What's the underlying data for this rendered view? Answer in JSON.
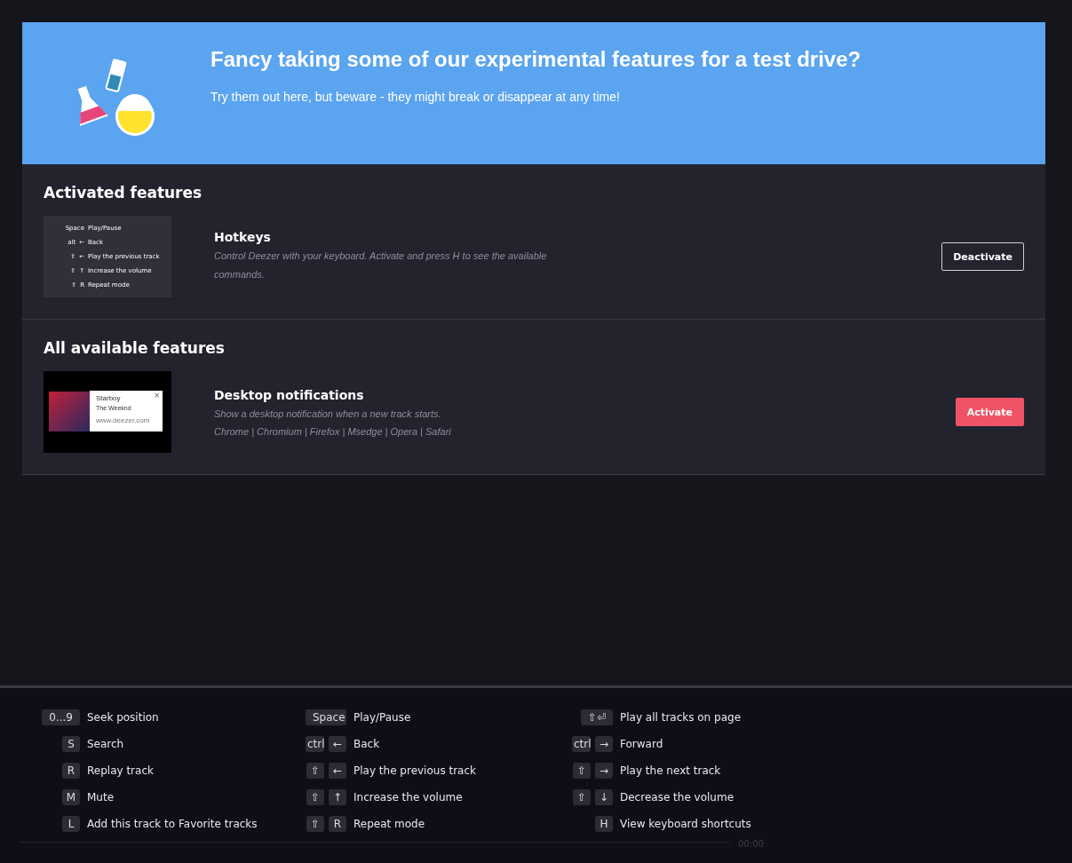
{
  "banner": {
    "title": "Fancy taking some of our experimental features for a test drive?",
    "subtitle": "Try them out here, but beware - they might break or disappear at any time!"
  },
  "sections": [
    {
      "heading": "Activated features",
      "features": [
        {
          "name": "Hotkeys",
          "description": "Control Deezer with your keyboard. Activate and press H to see the available commands.",
          "preview": {
            "kind": "hotkeys",
            "rows": [
              {
                "keys": [
                  "Space"
                ],
                "action": "Play/Pause"
              },
              {
                "keys": [
                  "alt",
                  "←"
                ],
                "action": "Back"
              },
              {
                "keys": [
                  "⇧",
                  "←"
                ],
                "action": "Play the previous track"
              },
              {
                "keys": [
                  "⇧",
                  "↑"
                ],
                "action": "Increase the volume"
              },
              {
                "keys": [
                  "⇧",
                  "R"
                ],
                "action": "Repeat mode"
              }
            ]
          },
          "button": {
            "label": "Deactivate",
            "kind": "outline"
          }
        }
      ]
    },
    {
      "heading": "All available features",
      "features": [
        {
          "name": "Desktop notifications",
          "description": "Show a desktop notification when a new track starts.",
          "browsers": "Chrome | Chromium | Firefox | Msedge | Opera | Safari",
          "preview": {
            "kind": "notification",
            "title": "Starboy",
            "artist": "The Weeknd",
            "url": "www.deezer.com",
            "close": "×"
          },
          "button": {
            "label": "Activate",
            "kind": "primary"
          }
        }
      ]
    }
  ],
  "player": {
    "time": "00:00"
  },
  "shortcuts": [
    [
      {
        "keys": [
          "0...9"
        ],
        "action": "Seek position"
      },
      {
        "keys": [
          "S"
        ],
        "action": "Search"
      },
      {
        "keys": [
          "R"
        ],
        "action": "Replay track"
      },
      {
        "keys": [
          "M"
        ],
        "action": "Mute"
      },
      {
        "keys": [
          "L"
        ],
        "action": "Add this track to Favorite tracks"
      }
    ],
    [
      {
        "keys": [
          "Space"
        ],
        "action": "Play/Pause"
      },
      {
        "keys": [
          "ctrl",
          "←"
        ],
        "action": "Back"
      },
      {
        "keys": [
          "⇧",
          "←"
        ],
        "action": "Play the previous track"
      },
      {
        "keys": [
          "⇧",
          "↑"
        ],
        "action": "Increase the volume"
      },
      {
        "keys": [
          "⇧",
          "R"
        ],
        "action": "Repeat mode"
      }
    ],
    [
      {
        "keys": [
          "⇧⏎"
        ],
        "action": "Play all tracks on page"
      },
      {
        "keys": [
          "ctrl",
          "→"
        ],
        "action": "Forward"
      },
      {
        "keys": [
          "⇧",
          "→"
        ],
        "action": "Play the next track"
      },
      {
        "keys": [
          "⇧",
          "↓"
        ],
        "action": "Decrease the volume"
      },
      {
        "keys": [
          "H"
        ],
        "action": "View keyboard shortcuts"
      }
    ]
  ]
}
